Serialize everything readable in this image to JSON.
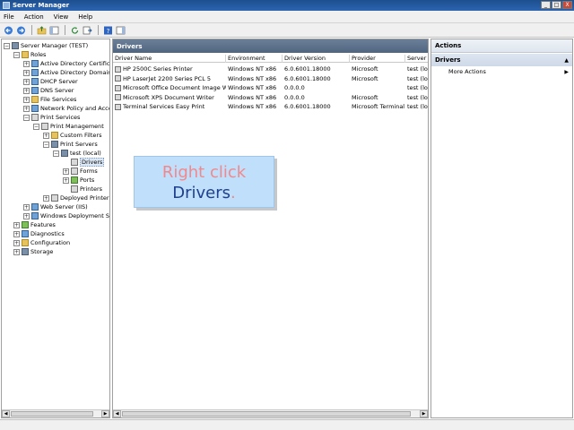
{
  "window": {
    "title": "Server Manager",
    "buttons": [
      "_",
      "□",
      "X"
    ]
  },
  "menu": [
    "File",
    "Action",
    "View",
    "Help"
  ],
  "tree": [
    {
      "label": "Server Manager (TEST)",
      "indent": 0,
      "exp": "−",
      "icon": "server"
    },
    {
      "label": "Roles",
      "indent": 1,
      "exp": "−",
      "icon": "folder"
    },
    {
      "label": "Active Directory Certificate Services",
      "indent": 2,
      "exp": "+",
      "icon": "role"
    },
    {
      "label": "Active Directory Domain Services",
      "indent": 2,
      "exp": "+",
      "icon": "role"
    },
    {
      "label": "DHCP Server",
      "indent": 2,
      "exp": "+",
      "icon": "role"
    },
    {
      "label": "DNS Server",
      "indent": 2,
      "exp": "+",
      "icon": "role"
    },
    {
      "label": "File Services",
      "indent": 2,
      "exp": "+",
      "icon": "folder"
    },
    {
      "label": "Network Policy and Access Services",
      "indent": 2,
      "exp": "+",
      "icon": "role"
    },
    {
      "label": "Print Services",
      "indent": 2,
      "exp": "−",
      "icon": "printer"
    },
    {
      "label": "Print Management",
      "indent": 3,
      "exp": "−",
      "icon": "printer"
    },
    {
      "label": "Custom Filters",
      "indent": 4,
      "exp": "+",
      "icon": "folder"
    },
    {
      "label": "Print Servers",
      "indent": 4,
      "exp": "−",
      "icon": "server"
    },
    {
      "label": "test (local)",
      "indent": 5,
      "exp": "−",
      "icon": "server"
    },
    {
      "label": "Drivers",
      "indent": 6,
      "exp": "",
      "icon": "printer",
      "selected": true
    },
    {
      "label": "Forms",
      "indent": 6,
      "exp": "+",
      "icon": "printer"
    },
    {
      "label": "Ports",
      "indent": 6,
      "exp": "+",
      "icon": "green"
    },
    {
      "label": "Printers",
      "indent": 6,
      "exp": "",
      "icon": "printer"
    },
    {
      "label": "Deployed Printers",
      "indent": 4,
      "exp": "+",
      "icon": "printer"
    },
    {
      "label": "Web Server (IIS)",
      "indent": 2,
      "exp": "+",
      "icon": "role"
    },
    {
      "label": "Windows Deployment Services",
      "indent": 2,
      "exp": "+",
      "icon": "role"
    },
    {
      "label": "Features",
      "indent": 1,
      "exp": "+",
      "icon": "green"
    },
    {
      "label": "Diagnostics",
      "indent": 1,
      "exp": "+",
      "icon": "role"
    },
    {
      "label": "Configuration",
      "indent": 1,
      "exp": "+",
      "icon": "folder"
    },
    {
      "label": "Storage",
      "indent": 1,
      "exp": "+",
      "icon": "server"
    }
  ],
  "middle": {
    "header": "Drivers",
    "columns": [
      "Driver Name",
      "Environment",
      "Driver Version",
      "Provider",
      "Server Name"
    ],
    "rows": [
      [
        "HP 2500C Series Printer",
        "Windows NT x86",
        "6.0.6001.18000",
        "Microsoft",
        "test (local)"
      ],
      [
        "HP LaserJet 2200 Series PCL 5",
        "Windows NT x86",
        "6.0.6001.18000",
        "Microsoft",
        "test (local)"
      ],
      [
        "Microsoft Office Document Image Writer Driver",
        "Windows NT x86",
        "0.0.0.0",
        "",
        "test (local)"
      ],
      [
        "Microsoft XPS Document Writer",
        "Windows NT x86",
        "0.0.0.0",
        "Microsoft",
        "test (local)"
      ],
      [
        "Terminal Services Easy Print",
        "Windows NT x86",
        "6.0.6001.18000",
        "Microsoft Terminal Services",
        "test (local)"
      ]
    ]
  },
  "callout": {
    "line1": "Right click",
    "line2": "Drivers",
    "line2_dot": "."
  },
  "actions": {
    "header": "Actions",
    "section": "Drivers",
    "section_caret": "▲",
    "items": [
      {
        "label": "More Actions",
        "arrow": "▶"
      }
    ]
  },
  "scroll": {
    "left": "◀",
    "right": "▶"
  }
}
